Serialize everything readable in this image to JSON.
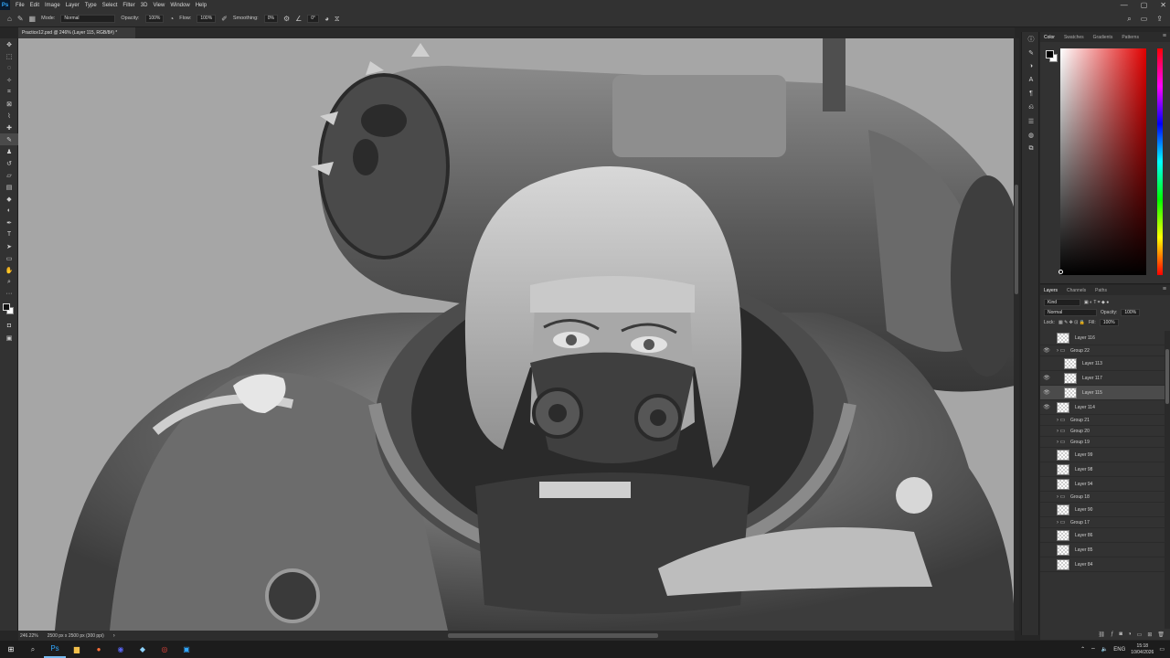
{
  "app": {
    "logo": "Ps"
  },
  "menu": [
    "File",
    "Edit",
    "Image",
    "Layer",
    "Type",
    "Select",
    "Filter",
    "3D",
    "View",
    "Window",
    "Help"
  ],
  "window_controls": [
    "—",
    "▢",
    "✕"
  ],
  "options": {
    "mode_label": "Mode:",
    "mode_value": "Normal",
    "opacity_label": "Opacity:",
    "opacity_value": "100%",
    "flow_label": "Flow:",
    "flow_value": "100%",
    "smoothing_label": "Smoothing:",
    "smoothing_value": "0%",
    "angle_value": "0°"
  },
  "document_tab": "Practice12.psd @ 246% (Layer 115, RGB/8#) *",
  "statusbar": {
    "zoom": "246.22%",
    "size": "2500 px x 2500 px (300 ppi)"
  },
  "color_panel": {
    "tabs": [
      "Color",
      "Swatches",
      "Gradients",
      "Patterns"
    ],
    "fg": "#000000",
    "bg": "#ffffff"
  },
  "layers_panel": {
    "tabs": [
      "Layers",
      "Channels",
      "Paths"
    ],
    "filter": "Kind",
    "blend": "Normal",
    "opacity_label": "Opacity:",
    "opacity_value": "100%",
    "lock_label": "Lock:",
    "fill_label": "Fill:",
    "fill_value": "100%",
    "layers": [
      {
        "name": "Layer 116",
        "type": "layer",
        "eye": false,
        "indent": 0
      },
      {
        "name": "Group 22",
        "type": "group",
        "eye": true,
        "indent": 0
      },
      {
        "name": "Layer 113",
        "type": "layer",
        "eye": false,
        "indent": 1
      },
      {
        "name": "Layer 117",
        "type": "layer",
        "eye": true,
        "indent": 1
      },
      {
        "name": "Layer 115",
        "type": "layer",
        "eye": true,
        "indent": 1,
        "selected": true
      },
      {
        "name": "Layer 114",
        "type": "layer",
        "eye": true,
        "indent": 0
      },
      {
        "name": "Group 21",
        "type": "group",
        "eye": false,
        "indent": 0
      },
      {
        "name": "Group 20",
        "type": "group",
        "eye": false,
        "indent": 0
      },
      {
        "name": "Group 19",
        "type": "group",
        "eye": false,
        "indent": 0
      },
      {
        "name": "Layer 99",
        "type": "layer",
        "eye": false,
        "indent": 0
      },
      {
        "name": "Layer 98",
        "type": "layer",
        "eye": false,
        "indent": 0
      },
      {
        "name": "Layer 94",
        "type": "layer",
        "eye": false,
        "indent": 0
      },
      {
        "name": "Group 18",
        "type": "group",
        "eye": false,
        "indent": 0
      },
      {
        "name": "Layer 90",
        "type": "layer",
        "eye": false,
        "indent": 0
      },
      {
        "name": "Group 17",
        "type": "group",
        "eye": false,
        "indent": 0
      },
      {
        "name": "Layer 86",
        "type": "layer",
        "eye": false,
        "indent": 0
      },
      {
        "name": "Layer 85",
        "type": "layer",
        "eye": false,
        "indent": 0
      },
      {
        "name": "Layer 84",
        "type": "layer",
        "eye": false,
        "indent": 0
      }
    ]
  },
  "taskbar": {
    "lang": "ENG",
    "time": "15:18",
    "date": "10/04/2026",
    "apps": [
      {
        "name": "windows",
        "glyph": "⊞",
        "color": "#ffffff"
      },
      {
        "name": "search",
        "glyph": "⌕",
        "color": "#cccccc"
      },
      {
        "name": "photoshop",
        "glyph": "Ps",
        "color": "#31a8ff",
        "active": true
      },
      {
        "name": "explorer",
        "glyph": "▆",
        "color": "#f3c04b"
      },
      {
        "name": "firefox",
        "glyph": "●",
        "color": "#ff7139"
      },
      {
        "name": "discord",
        "glyph": "◉",
        "color": "#5865f2"
      },
      {
        "name": "app",
        "glyph": "◆",
        "color": "#8fd3ff"
      },
      {
        "name": "obs",
        "glyph": "◎",
        "color": "#e6443b"
      },
      {
        "name": "photoshop-2",
        "glyph": "▣",
        "color": "#31a8ff"
      }
    ]
  }
}
